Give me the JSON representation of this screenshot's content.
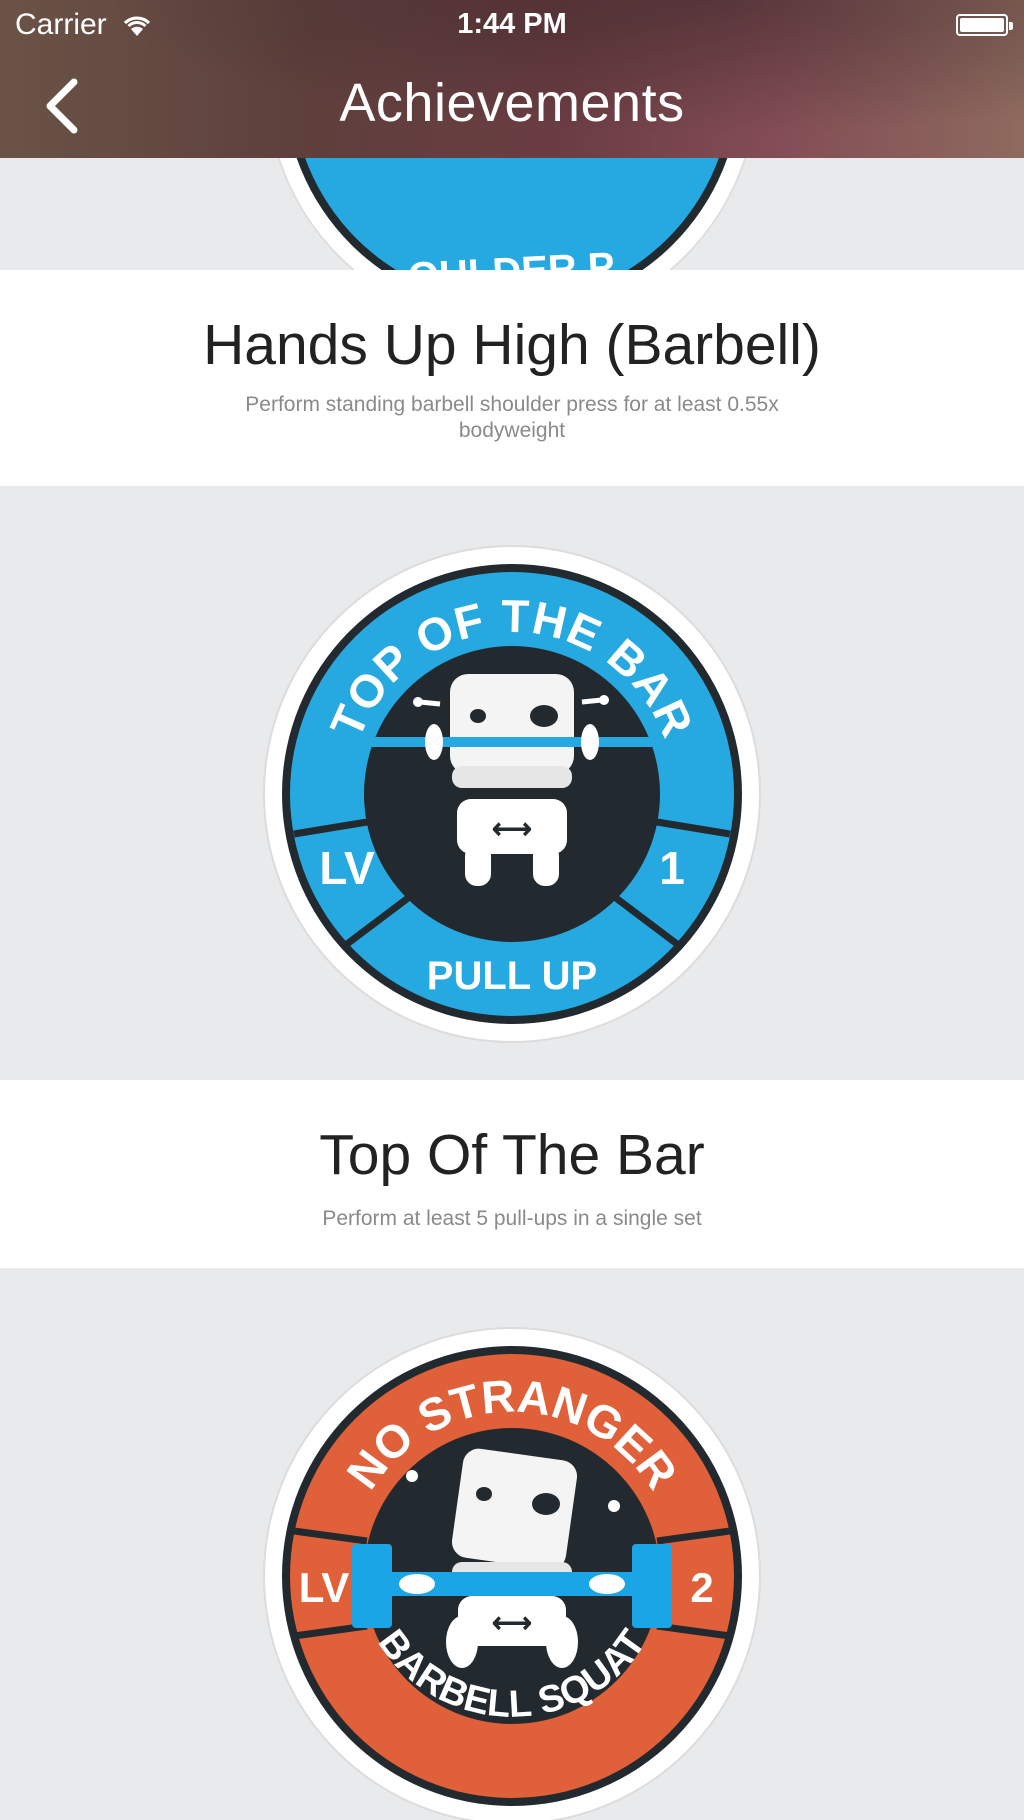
{
  "status_bar": {
    "carrier": "Carrier",
    "time": "1:44 PM"
  },
  "header": {
    "title": "Achievements"
  },
  "achievements": [
    {
      "title": "Hands Up High (Barbell)",
      "description": "Perform standing barbell shoulder press for at least 0.55x bodyweight",
      "badge": {
        "partial_text": "OULDER P",
        "color": "#26a9e0"
      }
    },
    {
      "title": "Top Of The Bar",
      "description": "Perform at least 5 pull-ups in a single set",
      "badge": {
        "top_text": "TOP OF THE BAR",
        "bottom_text": "PULL UP",
        "left_text": "LV",
        "right_text": "1",
        "color": "#26a9e0"
      }
    },
    {
      "badge": {
        "top_text": "NO STRANGER",
        "bottom_text": "BARBELL SQUAT",
        "left_text": "LV",
        "right_text": "2",
        "color": "#e0603a"
      }
    }
  ]
}
